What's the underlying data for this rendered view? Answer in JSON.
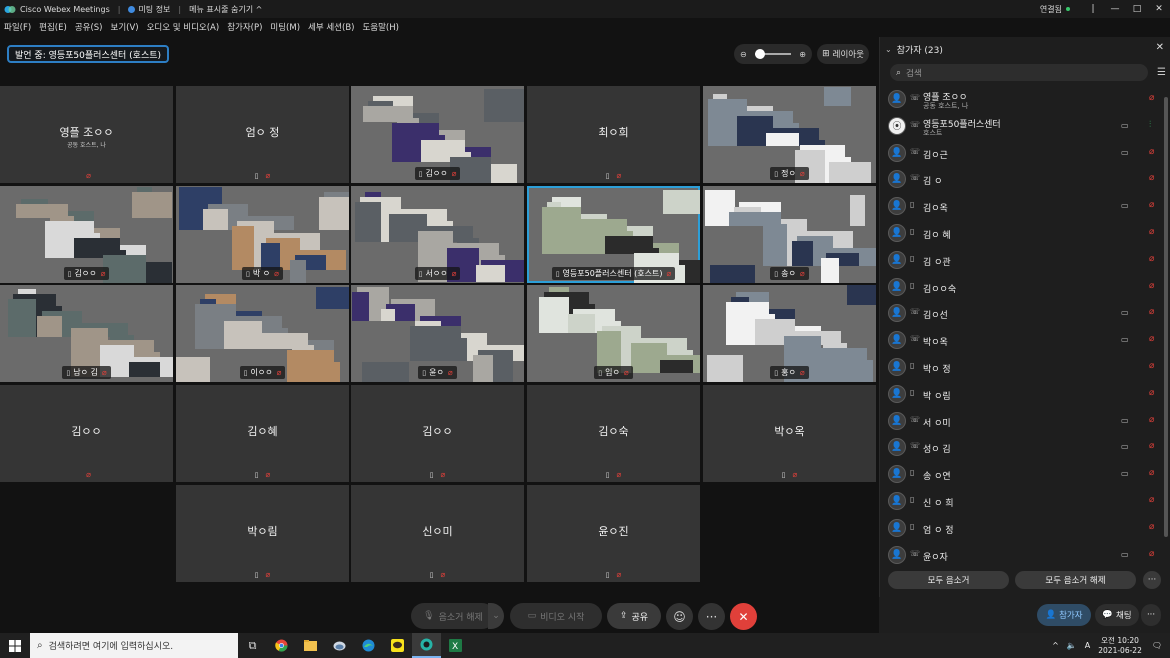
{
  "titlebar": {
    "app_title": "Cisco Webex Meetings",
    "meeting_info": "미팅 정보",
    "hide_menu": "메뉴 표시줄 숨기기 ^",
    "connection": "연결됨",
    "controls": [
      "—",
      "□",
      "✕"
    ]
  },
  "menubar": [
    "파일(F)",
    "편집(E)",
    "공유(S)",
    "보기(V)",
    "오디오 및 비디오(A)",
    "참가자(P)",
    "미팅(M)",
    "세부 세션(B)",
    "도움말(H)"
  ],
  "speaking": "발언 중: 영등포50플러스센터 (호스트)",
  "layout_button": "레이아웃",
  "tiles": [
    {
      "name": "영플 조ㅇㅇ",
      "sub": "공동 호스트, 나",
      "label": "",
      "video": false
    },
    {
      "name": "엄ㅇ 정",
      "sub": "",
      "label": "",
      "video": false
    },
    {
      "name": "",
      "sub": "",
      "label": "김ㅇㅇ",
      "video": true
    },
    {
      "name": "최ㅇ희",
      "sub": "",
      "label": "",
      "video": false
    },
    {
      "name": "",
      "sub": "",
      "label": "정ㅇ",
      "video": true
    },
    {
      "name": "",
      "sub": "",
      "label": "김ㅇㅇ",
      "video": true
    },
    {
      "name": "",
      "sub": "",
      "label": "박 ㅇ",
      "video": true
    },
    {
      "name": "",
      "sub": "",
      "label": "서ㅇㅇ",
      "video": true
    },
    {
      "name": "",
      "sub": "",
      "label": "영등포50플러스센터 (호스트)",
      "video": true
    },
    {
      "name": "",
      "sub": "",
      "label": "송ㅇ",
      "video": true
    },
    {
      "name": "",
      "sub": "",
      "label": "남ㅇ 김",
      "video": true
    },
    {
      "name": "",
      "sub": "",
      "label": "이ㅇㅇ",
      "video": true
    },
    {
      "name": "",
      "sub": "",
      "label": "윤ㅇ",
      "video": true
    },
    {
      "name": "",
      "sub": "",
      "label": "임ㅇ",
      "video": true
    },
    {
      "name": "",
      "sub": "",
      "label": "홍ㅇ",
      "video": true
    },
    {
      "name": "김ㅇㅇ",
      "sub": "",
      "label": "",
      "video": false
    },
    {
      "name": "김ㅇ혜",
      "sub": "",
      "label": "",
      "video": false
    },
    {
      "name": "김ㅇㅇ",
      "sub": "",
      "label": "",
      "video": false
    },
    {
      "name": "김ㅇ숙",
      "sub": "",
      "label": "",
      "video": false
    },
    {
      "name": "박ㅇ옥",
      "sub": "",
      "label": "",
      "video": false
    },
    {
      "name": "박ㅇ림",
      "sub": "",
      "label": "",
      "video": false
    },
    {
      "name": "신ㅇ미",
      "sub": "",
      "label": "",
      "video": false
    },
    {
      "name": "윤ㅇ진",
      "sub": "",
      "label": "",
      "video": false
    }
  ],
  "controls": {
    "unmute": "음소거 해제",
    "video": "비디오 시작",
    "share": "공유"
  },
  "panel": {
    "title": "참가자 (23)",
    "search_placeholder": "검색",
    "mute_all": "모두 음소거",
    "unmute_all": "모두 음소거 해제",
    "participants": [
      {
        "name": "영플 조ㅇㅇ",
        "role": "공동 호스트, 나",
        "dev": "phone",
        "cam": false,
        "mic_on": false
      },
      {
        "name": "영등포50플러스센터",
        "role": "호스트",
        "dev": "phone",
        "cam": true,
        "mic_on": true
      },
      {
        "name": "김ㅇ근",
        "role": "",
        "dev": "phone",
        "cam": true,
        "mic_on": false
      },
      {
        "name": "김 ㅇ",
        "role": "",
        "dev": "phone",
        "cam": false,
        "mic_on": false
      },
      {
        "name": "김ㅇ옥",
        "role": "",
        "dev": "mobile",
        "cam": true,
        "mic_on": false
      },
      {
        "name": "김ㅇ 혜",
        "role": "",
        "dev": "mobile",
        "cam": false,
        "mic_on": false
      },
      {
        "name": "김 ㅇ관",
        "role": "",
        "dev": "mobile",
        "cam": false,
        "mic_on": false
      },
      {
        "name": "김ㅇㅇ숙",
        "role": "",
        "dev": "mobile",
        "cam": false,
        "mic_on": false
      },
      {
        "name": "김ㅇ선",
        "role": "",
        "dev": "phone",
        "cam": true,
        "mic_on": false
      },
      {
        "name": "박ㅇ옥",
        "role": "",
        "dev": "phone",
        "cam": true,
        "mic_on": false
      },
      {
        "name": "박ㅇ 정",
        "role": "",
        "dev": "mobile",
        "cam": false,
        "mic_on": false
      },
      {
        "name": "박 ㅇ림",
        "role": "",
        "dev": "mobile",
        "cam": false,
        "mic_on": false
      },
      {
        "name": "서 ㅇ미",
        "role": "",
        "dev": "phone",
        "cam": true,
        "mic_on": false
      },
      {
        "name": "성ㅇ 김",
        "role": "",
        "dev": "phone",
        "cam": true,
        "mic_on": false
      },
      {
        "name": "송 ㅇ연",
        "role": "",
        "dev": "mobile",
        "cam": true,
        "mic_on": false
      },
      {
        "name": "신 ㅇ 희",
        "role": "",
        "dev": "mobile",
        "cam": false,
        "mic_on": false
      },
      {
        "name": "엄 ㅇ 정",
        "role": "",
        "dev": "mobile",
        "cam": false,
        "mic_on": false
      },
      {
        "name": "윤ㅇ자",
        "role": "",
        "dev": "phone",
        "cam": true,
        "mic_on": false
      }
    ]
  },
  "panelfoot": {
    "participants": "참가자",
    "chat": "채팅"
  },
  "taskbar": {
    "search_placeholder": "검색하려면 여기에 입력하십시오.",
    "ime": "A",
    "time": "오전 10:20",
    "date": "2021-06-22"
  }
}
